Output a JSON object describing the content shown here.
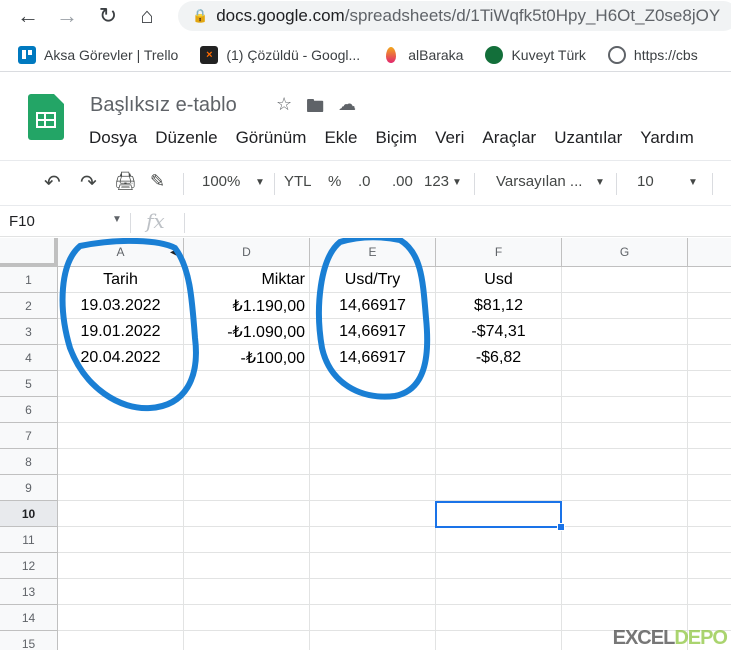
{
  "browser": {
    "url_host": "docs.google.com",
    "url_path": "/spreadsheets/d/1TiWqfk5t0Hpy_H6Ot_Z0se8jOY",
    "bookmarks": [
      {
        "label": "Aksa Görevler | Trello",
        "icon": "trello-icon"
      },
      {
        "label": "(1) Çözüldü - Googl...",
        "icon": "solved-icon"
      },
      {
        "label": "alBaraka",
        "icon": "albaraka-icon"
      },
      {
        "label": "Kuveyt Türk",
        "icon": "kuveyt-turk-icon"
      },
      {
        "label": "https://cbs",
        "icon": "globe-icon"
      }
    ]
  },
  "doc": {
    "title": "Başlıksız e-tablo",
    "menu": [
      "Dosya",
      "Düzenle",
      "Görünüm",
      "Ekle",
      "Biçim",
      "Veri",
      "Araçlar",
      "Uzantılar",
      "Yardım"
    ]
  },
  "toolbar": {
    "zoom": "100%",
    "currency": "YTL",
    "percent": "%",
    "dec_decrease": ".0",
    "dec_increase": ".00",
    "more_formats": "123",
    "font": "Varsayılan ...",
    "font_size": "10"
  },
  "formula_bar": {
    "name_box": "F10",
    "fx": "fx"
  },
  "grid": {
    "columns": [
      "A",
      "D",
      "E",
      "F",
      "G"
    ],
    "rows": [
      "1",
      "2",
      "3",
      "4",
      "5",
      "6",
      "7",
      "8",
      "9",
      "10",
      "11",
      "12",
      "13",
      "14",
      "15"
    ],
    "selected_row": "10",
    "data": [
      [
        "Tarih",
        "Miktar",
        "Usd/Try",
        "Usd"
      ],
      [
        "19.03.2022",
        "₺1.190,00",
        "14,66917",
        "$81,12"
      ],
      [
        "19.01.2022",
        "-₺1.090,00",
        "14,66917",
        "-$74,31"
      ],
      [
        "20.04.2022",
        "-₺100,00",
        "14,66917",
        "-$6,82"
      ]
    ]
  },
  "annotation_color": "#1a7fd4",
  "watermark": {
    "left": "EXCEL",
    "right": "DEPO"
  }
}
